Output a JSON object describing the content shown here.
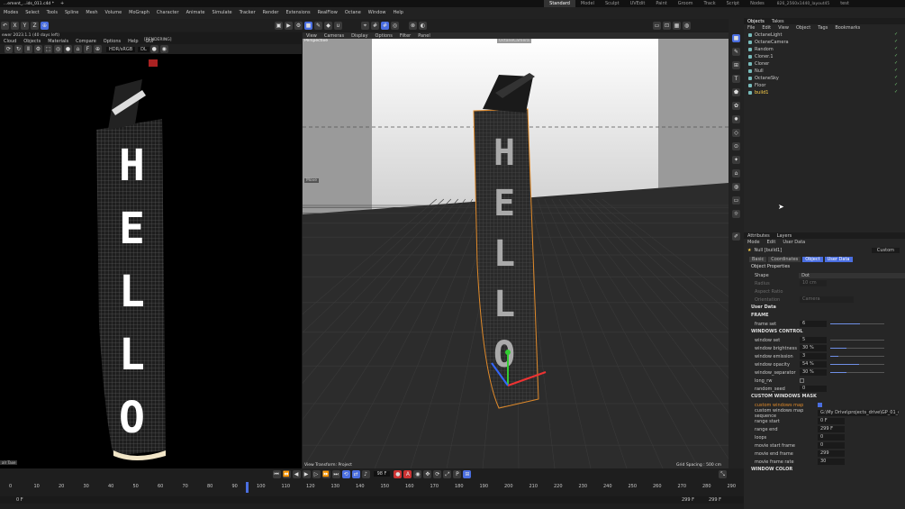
{
  "tabs": {
    "file": "...ement_...ids_011.c4d *",
    "items": [
      "Standard",
      "Model",
      "Sculpt",
      "UVEdit",
      "Paint",
      "Groom",
      "Track",
      "Script",
      "Nodes"
    ],
    "active": 0,
    "layout": "826_2560x1440_layout45",
    "last": "test"
  },
  "menu": [
    "Modes",
    "Select",
    "Tools",
    "Spline",
    "Mesh",
    "Volume",
    "MoGraph",
    "Character",
    "Animate",
    "Simulate",
    "Tracker",
    "Render",
    "Extensions",
    "RealFlow",
    "Octane",
    "Window",
    "Help"
  ],
  "toolbar": {
    "xyz": [
      "X",
      "Y",
      "Z"
    ]
  },
  "octane": {
    "title": "ewer 2023.1.1 (40 days left)",
    "menu": [
      "Cloud",
      "Objects",
      "Materials",
      "Compare",
      "Options",
      "Help",
      "GUI"
    ],
    "status": "[RENDERING]",
    "hdr": "HDR/sRGB",
    "dl": "DL"
  },
  "viewport": {
    "menu": [
      "View",
      "Cameras",
      "Display",
      "Options",
      "Filter",
      "Panel"
    ],
    "label": "Perspective",
    "camera": "OctaneCamera",
    "move": "Move",
    "transform": "View Transform: Project",
    "grid": "Grid Spacing : 500 cm",
    "sign": [
      "H",
      "E",
      "L",
      "L",
      "O"
    ]
  },
  "objects": {
    "tabs": [
      "Objects",
      "Takes"
    ],
    "menu": [
      "File",
      "Edit",
      "View",
      "Object",
      "Tags",
      "Bookmarks"
    ],
    "items": [
      "OctaneLight",
      "OctaneCamera",
      "Random",
      "Cloner.1",
      "Cloner",
      "Null",
      "OctaneSky",
      "Floor",
      "build1"
    ],
    "selected": 8
  },
  "attributes": {
    "tabs": [
      "Attributes",
      "Layers"
    ],
    "menu": [
      "Mode",
      "Edit",
      "User Data"
    ],
    "object": "Null [build1]",
    "preset": "Custom",
    "subtabs": [
      "Basic",
      "Coordinates",
      "Object",
      "User Data"
    ],
    "active_subtabs": [
      2,
      3
    ],
    "props_title": "Object Properties",
    "shape_label": "Shape",
    "shape_value": "Dot",
    "radius_label": "Radius",
    "radius_value": "10 cm",
    "aspect_label": "Aspect Ratio",
    "orientation_label": "Orientation",
    "orientation_value": "Camera",
    "user_data": "User Data",
    "frame_section": "FRAME",
    "frame_label": "frame set",
    "frame_value": "6",
    "frame_fill": 0.55,
    "windows_section": "WINDOWS CONTROL",
    "windows": [
      {
        "label": "window set",
        "value": "5",
        "fill": 0.0
      },
      {
        "label": "window brightness",
        "value": "30 %",
        "fill": 0.3
      },
      {
        "label": "window emission",
        "value": "3",
        "fill": 0.15
      },
      {
        "label": "window opacity",
        "value": "54 %",
        "fill": 0.54
      },
      {
        "label": "window_separator",
        "value": "30 %",
        "fill": 0.3
      },
      {
        "label": "long_rw",
        "value": ""
      },
      {
        "label": "random_seed",
        "value": "0"
      }
    ],
    "custom_section": "CUSTOM WINDOWS MASK",
    "custom": [
      {
        "label": "custom windows map",
        "value": ""
      },
      {
        "label": "custom windows map sequence",
        "value": "G:\\My Drive\\projects_drive\\GP_01_city_"
      },
      {
        "label": "range start",
        "value": "0 F"
      },
      {
        "label": "range end",
        "value": "299 F"
      },
      {
        "label": "loops",
        "value": "0"
      },
      {
        "label": "movie start frame",
        "value": "0"
      },
      {
        "label": "movie end frame",
        "value": "299"
      },
      {
        "label": "movie frame rate",
        "value": "30"
      }
    ],
    "color_section": "WINDOW COLOR"
  },
  "timeline": {
    "ticks": [
      "0",
      "10",
      "20",
      "30",
      "40",
      "50",
      "60",
      "70",
      "80",
      "90",
      "100",
      "110",
      "120",
      "130",
      "140",
      "150",
      "160",
      "170",
      "180",
      "190",
      "200",
      "210",
      "220",
      "230",
      "240",
      "250",
      "260",
      "270",
      "280",
      "290"
    ],
    "start": "0 F",
    "current": "98 F",
    "end": "299 F",
    "end2": "299 F",
    "playhead": 0.33,
    "left_label": "alr Taxe"
  },
  "colors": {
    "accent": "#4a6ee0",
    "selected": "#ffd24a",
    "orange": "#e08a2a"
  }
}
